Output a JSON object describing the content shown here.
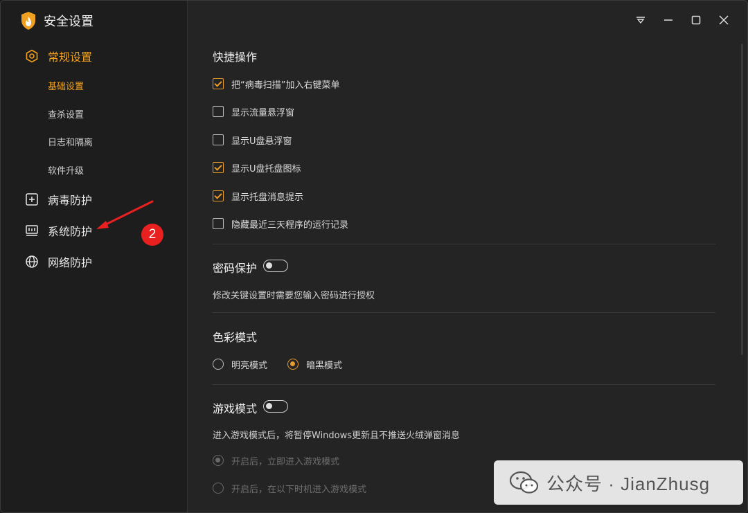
{
  "app": {
    "title": "安全设置"
  },
  "colors": {
    "accent": "#f0a020",
    "annotation": "#e8201f"
  },
  "sidebar": {
    "items": [
      {
        "label": "常规设置",
        "icon": "gear-icon",
        "active": true
      },
      {
        "label": "病毒防护",
        "icon": "plus-square-icon"
      },
      {
        "label": "系统防护",
        "icon": "system-monitor-icon"
      },
      {
        "label": "网络防护",
        "icon": "globe-icon"
      }
    ],
    "subitems": [
      {
        "label": "基础设置",
        "active": true
      },
      {
        "label": "查杀设置"
      },
      {
        "label": "日志和隔离"
      },
      {
        "label": "软件升级"
      }
    ]
  },
  "annotation": {
    "badge": "2"
  },
  "window_controls": [
    "dropdown-icon",
    "minimize-icon",
    "maximize-icon",
    "close-icon"
  ],
  "main": {
    "quick_ops": {
      "title": "快捷操作",
      "options": [
        {
          "label": "把“病毒扫描”加入右键菜单",
          "checked": true
        },
        {
          "label": "显示流量悬浮窗",
          "checked": false
        },
        {
          "label": "显示U盘悬浮窗",
          "checked": false
        },
        {
          "label": "显示U盘托盘图标",
          "checked": true
        },
        {
          "label": "显示托盘消息提示",
          "checked": true
        },
        {
          "label": "隐藏最近三天程序的运行记录",
          "checked": false
        }
      ]
    },
    "password": {
      "title": "密码保护",
      "enabled": false,
      "desc": "修改关键设置时需要您输入密码进行授权"
    },
    "color_mode": {
      "title": "色彩模式",
      "options": [
        {
          "label": "明亮模式",
          "selected": false
        },
        {
          "label": "暗黑模式",
          "selected": true
        }
      ]
    },
    "game_mode": {
      "title": "游戏模式",
      "enabled": false,
      "desc": "进入游戏模式后，将暂停Windows更新且不推送火绒弹窗消息",
      "options": [
        {
          "label": "开启后，立即进入游戏模式",
          "selected": true,
          "disabled": true
        },
        {
          "label": "开启后，在以下时机进入游戏模式",
          "selected": false,
          "disabled": true
        }
      ]
    }
  },
  "watermark": {
    "text": "公众号 · JianZhusg"
  }
}
